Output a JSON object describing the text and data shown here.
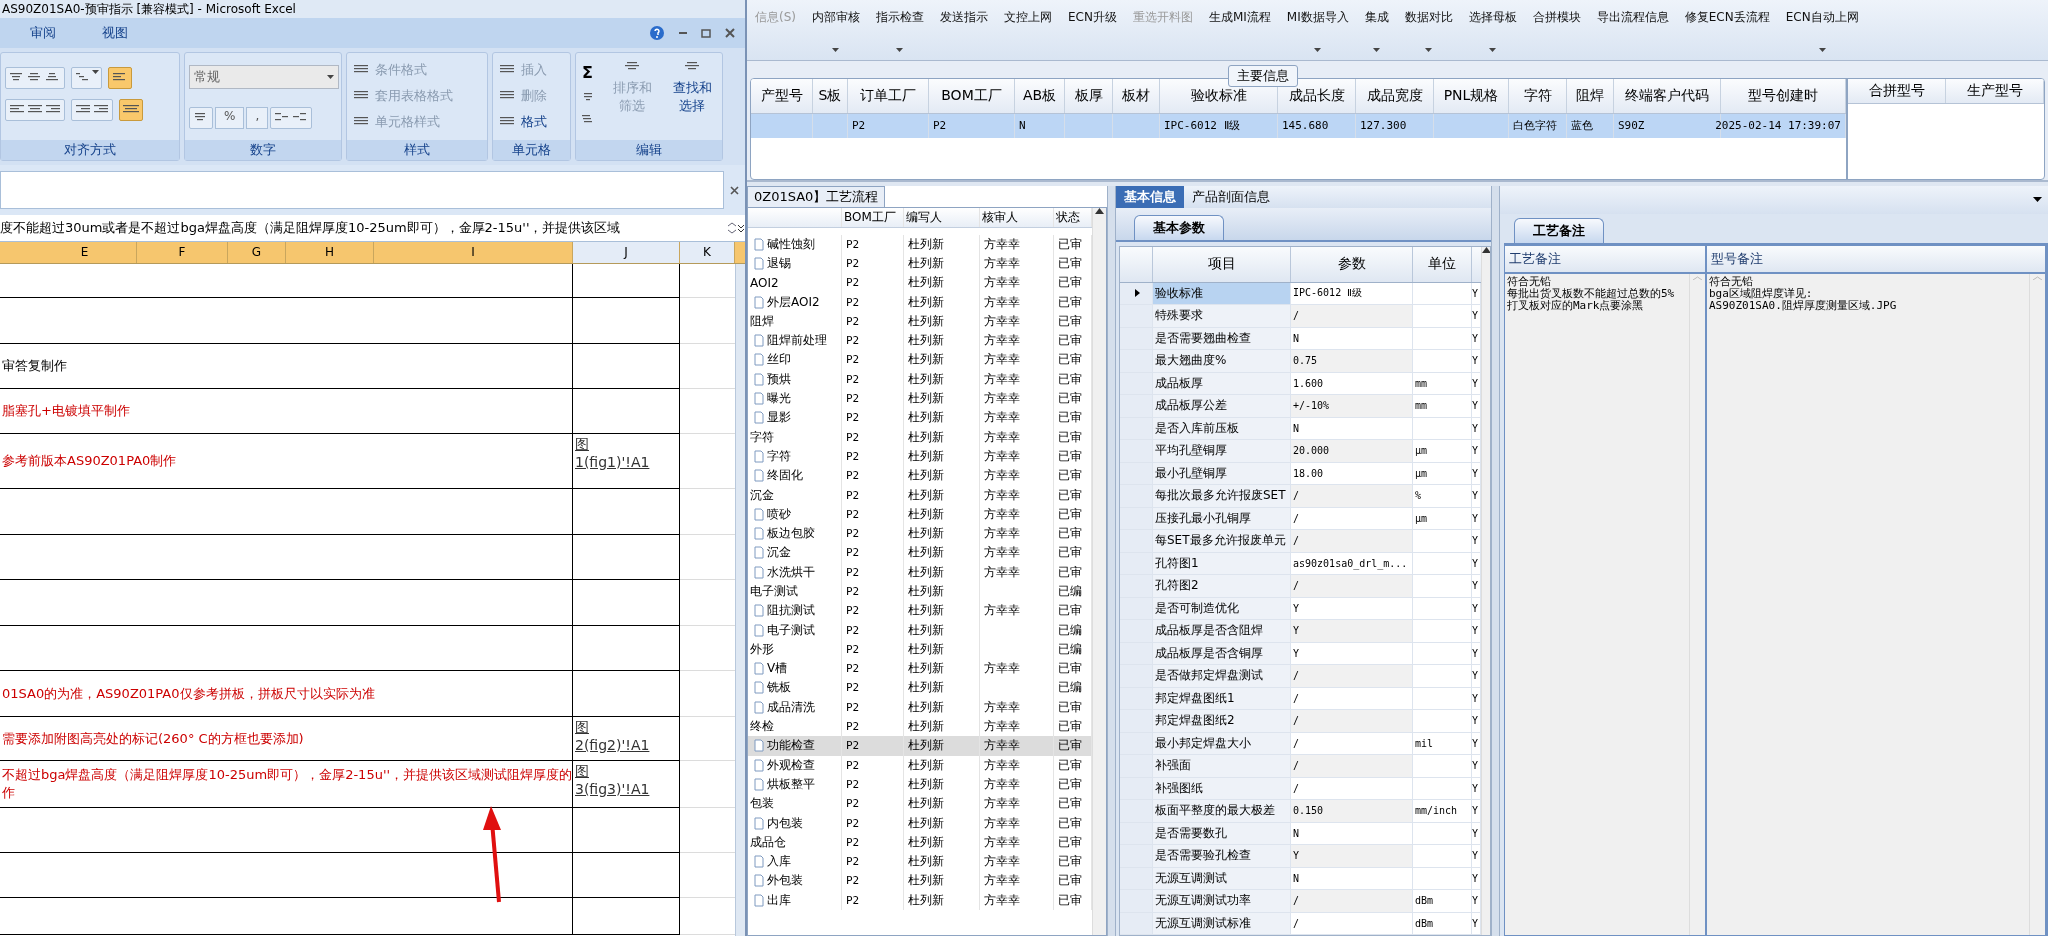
{
  "excel": {
    "title": "AS90Z01SA0-预审指示 [兼容模式] - Microsoft Excel",
    "ribbon_tabs": [
      {
        "label": "审阅",
        "selected": false
      },
      {
        "label": "视图",
        "selected": false
      }
    ],
    "alignment": {
      "label": "对齐方式",
      "wrap_text": true,
      "merge_center": true
    },
    "number": {
      "label": "数字",
      "format": "常规",
      "symbols": [
        "%",
        ","
      ]
    },
    "styles": {
      "label": "样式",
      "items": [
        {
          "label": "条件格式",
          "disabled": true
        },
        {
          "label": "套用表格格式",
          "disabled": true
        },
        {
          "label": "单元格样式",
          "disabled": true
        }
      ]
    },
    "cells": {
      "label": "单元格",
      "items": [
        {
          "label": "插入",
          "disabled": true
        },
        {
          "label": "删除",
          "disabled": true
        },
        {
          "label": "格式",
          "disabled": false
        }
      ]
    },
    "editing": {
      "label": "编辑",
      "sum": "Σ",
      "items": [
        {
          "label": "排序和筛选",
          "disabled": true
        },
        {
          "label": "查找和选择",
          "disabled": false
        }
      ]
    },
    "formula": "度不能超过30um或者是不超过bga焊盘高度（满足阻焊厚度10-25um即可），金厚2-15u''，并提供该区域",
    "columns": [
      "E",
      "F",
      "G",
      "H",
      "I",
      "J",
      "K"
    ],
    "rows": [
      {},
      {},
      {
        "lines": [
          "审答复制作"
        ],
        "color": "#000000"
      },
      {
        "lines": [
          "脂塞孔+电镀填平制作"
        ],
        "color": "#cc0000"
      },
      {
        "lines": [
          "参考前版本AS90Z01PA0制作"
        ],
        "color": "#cc0000",
        "link": "图 1(fig1)'!A1"
      },
      {},
      {},
      {},
      {},
      {
        "lines": [
          "01SA0的为准，AS90Z01PA0仅参考拼板，拼板尺寸以实际为准"
        ],
        "color": "#cc0000"
      },
      {
        "lines": [
          "需要添加附图高亮处的标记(260° C的方框也要添加)"
        ],
        "color": "#cc0000",
        "link": "图 2(fig2)'!A1"
      },
      {
        "lines": [
          "不超过bga焊盘高度（满足阻焊厚度10-25um即可），金厚2-15u''，并提供该区域测试阻焊厚度的",
          "作"
        ],
        "color": "#cc0000",
        "link": "图 3(fig3)'!A1"
      },
      {},
      {},
      {}
    ]
  },
  "toolbar": [
    {
      "label": "信息(S)",
      "disabled": true,
      "dropdown": false
    },
    {
      "label": "内部审核",
      "disabled": false,
      "dropdown": true
    },
    {
      "label": "指示检查",
      "disabled": false,
      "dropdown": true
    },
    {
      "label": "发送指示",
      "disabled": false,
      "dropdown": false
    },
    {
      "label": "文控上网",
      "disabled": false,
      "dropdown": false
    },
    {
      "label": "ECN升级",
      "disabled": false,
      "dropdown": false
    },
    {
      "label": "重选开料图",
      "disabled": true,
      "dropdown": false
    },
    {
      "label": "生成MI流程",
      "disabled": false,
      "dropdown": false
    },
    {
      "label": "MI数据导入",
      "disabled": false,
      "dropdown": true
    },
    {
      "label": "集成",
      "disabled": false,
      "dropdown": true
    },
    {
      "label": "数据对比",
      "disabled": false,
      "dropdown": true
    },
    {
      "label": "选择母板",
      "disabled": false,
      "dropdown": true
    },
    {
      "label": "合拼模块",
      "disabled": false,
      "dropdown": false
    },
    {
      "label": "导出流程信息",
      "disabled": false,
      "dropdown": false
    },
    {
      "label": "修复ECN丢流程",
      "disabled": false,
      "dropdown": false
    },
    {
      "label": "ECN自动上网",
      "disabled": false,
      "dropdown": true
    }
  ],
  "main_info": {
    "title": "主要信息",
    "columns": [
      "产型号",
      "S板",
      "订单工厂",
      "BOM工厂",
      "AB板",
      "板厚",
      "板材",
      "验收标准",
      "成品长度",
      "成品宽度",
      "PNL规格",
      "字符",
      "阻焊",
      "终端客户代码",
      "型号创建时"
    ],
    "rows": [
      {
        "selected": true,
        "cells": [
          "",
          "",
          "P2",
          "P2",
          "N",
          "",
          "",
          "IPC-6012 Ⅱ级",
          "145.680",
          "127.300",
          "",
          "白色字符",
          "蓝色",
          "S90Z",
          "2025-02-14 17:39:07"
        ]
      }
    ],
    "merge_columns": [
      "合拼型号",
      "生产型号"
    ]
  },
  "process": {
    "tab": "0Z01SA0】工艺流程",
    "columns": [
      "",
      "BOM工厂",
      "编写人",
      "核审人",
      "状态"
    ],
    "rows": [
      {
        "children": [
          {
            "name": "碱性蚀刻",
            "bom": "P2",
            "writer": "杜列新",
            "reviewer": "方幸幸",
            "status": "已审",
            "selected": false
          },
          {
            "name": "退锡",
            "bom": "P2",
            "writer": "杜列新",
            "reviewer": "方幸幸",
            "status": "已审",
            "selected": false
          }
        ]
      },
      {
        "name": "AOI2",
        "bom": "P2",
        "writer": "杜列新",
        "reviewer": "方幸幸",
        "status": "已审",
        "selected": false,
        "children": [
          {
            "name": "外层AOI2",
            "bom": "P2",
            "writer": "杜列新",
            "reviewer": "方幸幸",
            "status": "已审",
            "selected": false
          }
        ]
      },
      {
        "name": "阻焊",
        "bom": "P2",
        "writer": "杜列新",
        "reviewer": "方幸幸",
        "status": "已审",
        "selected": false,
        "children": [
          {
            "name": "阻焊前处理",
            "bom": "P2",
            "writer": "杜列新",
            "reviewer": "方幸幸",
            "status": "已审",
            "selected": false
          },
          {
            "name": "丝印",
            "bom": "P2",
            "writer": "杜列新",
            "reviewer": "方幸幸",
            "status": "已审",
            "selected": false
          },
          {
            "name": "预烘",
            "bom": "P2",
            "writer": "杜列新",
            "reviewer": "方幸幸",
            "status": "已审",
            "selected": false
          },
          {
            "name": "曝光",
            "bom": "P2",
            "writer": "杜列新",
            "reviewer": "方幸幸",
            "status": "已审",
            "selected": false
          },
          {
            "name": "显影",
            "bom": "P2",
            "writer": "杜列新",
            "reviewer": "方幸幸",
            "status": "已审",
            "selected": false
          }
        ]
      },
      {
        "name": "字符",
        "bom": "P2",
        "writer": "杜列新",
        "reviewer": "方幸幸",
        "status": "已审",
        "selected": false,
        "children": [
          {
            "name": "字符",
            "bom": "P2",
            "writer": "杜列新",
            "reviewer": "方幸幸",
            "status": "已审",
            "selected": false
          },
          {
            "name": "终固化",
            "bom": "P2",
            "writer": "杜列新",
            "reviewer": "方幸幸",
            "status": "已审",
            "selected": false
          }
        ]
      },
      {
        "name": "沉金",
        "bom": "P2",
        "writer": "杜列新",
        "reviewer": "方幸幸",
        "status": "已审",
        "selected": false,
        "children": [
          {
            "name": "喷砂",
            "bom": "P2",
            "writer": "杜列新",
            "reviewer": "方幸幸",
            "status": "已审",
            "selected": false
          },
          {
            "name": "板边包胶",
            "bom": "P2",
            "writer": "杜列新",
            "reviewer": "方幸幸",
            "status": "已审",
            "selected": false
          },
          {
            "name": "沉金",
            "bom": "P2",
            "writer": "杜列新",
            "reviewer": "方幸幸",
            "status": "已审",
            "selected": false
          },
          {
            "name": "水洗烘干",
            "bom": "P2",
            "writer": "杜列新",
            "reviewer": "方幸幸",
            "status": "已审",
            "selected": false
          }
        ]
      },
      {
        "name": "电子测试",
        "bom": "P2",
        "writer": "杜列新",
        "status": "已编",
        "selected": false,
        "children": [
          {
            "name": "阻抗测试",
            "bom": "P2",
            "writer": "杜列新",
            "reviewer": "方幸幸",
            "status": "已审",
            "selected": false
          },
          {
            "name": "电子测试",
            "bom": "P2",
            "writer": "杜列新",
            "status": "已编",
            "selected": false
          }
        ]
      },
      {
        "name": "外形",
        "bom": "P2",
        "writer": "杜列新",
        "status": "已编",
        "selected": false,
        "children": [
          {
            "name": "V槽",
            "bom": "P2",
            "writer": "杜列新",
            "reviewer": "方幸幸",
            "status": "已审",
            "selected": false
          },
          {
            "name": "铣板",
            "bom": "P2",
            "writer": "杜列新",
            "status": "已编",
            "selected": false
          },
          {
            "name": "成品清洗",
            "bom": "P2",
            "writer": "杜列新",
            "reviewer": "方幸幸",
            "status": "已审",
            "selected": false
          }
        ]
      },
      {
        "name": "终检",
        "bom": "P2",
        "writer": "杜列新",
        "reviewer": "方幸幸",
        "status": "已审",
        "selected": false,
        "children": [
          {
            "name": "功能检查",
            "bom": "P2",
            "writer": "杜列新",
            "reviewer": "方幸幸",
            "status": "已审",
            "selected": true
          },
          {
            "name": "外观检查",
            "bom": "P2",
            "writer": "杜列新",
            "reviewer": "方幸幸",
            "status": "已审",
            "selected": false
          },
          {
            "name": "烘板整平",
            "bom": "P2",
            "writer": "杜列新",
            "reviewer": "方幸幸",
            "status": "已审",
            "selected": false
          }
        ]
      },
      {
        "name": "包装",
        "bom": "P2",
        "writer": "杜列新",
        "reviewer": "方幸幸",
        "status": "已审",
        "selected": false,
        "children": [
          {
            "name": "内包装",
            "bom": "P2",
            "writer": "杜列新",
            "reviewer": "方幸幸",
            "status": "已审",
            "selected": false
          }
        ]
      },
      {
        "name": "成品仓",
        "bom": "P2",
        "writer": "杜列新",
        "reviewer": "方幸幸",
        "status": "已审",
        "selected": false,
        "children": [
          {
            "name": "入库",
            "bom": "P2",
            "writer": "杜列新",
            "reviewer": "方幸幸",
            "status": "已审",
            "selected": false
          },
          {
            "name": "外包装",
            "bom": "P2",
            "writer": "杜列新",
            "reviewer": "方幸幸",
            "status": "已审",
            "selected": false
          },
          {
            "name": "出库",
            "bom": "P2",
            "writer": "杜列新",
            "reviewer": "方幸幸",
            "status": "已审",
            "selected": false
          }
        ]
      }
    ]
  },
  "basic": {
    "tabs": [
      {
        "label": "基本信息",
        "selected": true
      },
      {
        "label": "产品剖面信息",
        "selected": false
      }
    ],
    "subtab": "基本参数",
    "columns": [
      "项目",
      "参数",
      "单位"
    ],
    "rows": [
      {
        "item": "验收标准",
        "value": "IPC-6012 Ⅱ级",
        "unit": "",
        "flag": "Y",
        "selected": true
      },
      {
        "item": "特殊要求",
        "value": "/",
        "unit": "",
        "flag": "Y",
        "selected": false
      },
      {
        "item": "是否需要翘曲检查",
        "value": "N",
        "unit": "",
        "flag": "Y",
        "selected": false
      },
      {
        "item": "最大翘曲度%",
        "value": "0.75",
        "unit": "",
        "flag": "Y",
        "selected": false
      },
      {
        "item": "成品板厚",
        "value": "1.600",
        "unit": "mm",
        "flag": "Y",
        "selected": false
      },
      {
        "item": "成品板厚公差",
        "value": "+/-10%",
        "unit": "mm",
        "flag": "Y",
        "selected": false
      },
      {
        "item": "是否入库前压板",
        "value": "N",
        "unit": "",
        "flag": "Y",
        "selected": false
      },
      {
        "item": "平均孔壁铜厚",
        "value": "20.000",
        "unit": "μm",
        "flag": "Y",
        "selected": false
      },
      {
        "item": "最小孔壁铜厚",
        "value": "18.00",
        "unit": "μm",
        "flag": "Y",
        "selected": false
      },
      {
        "item": "每批次最多允许报废SET",
        "value": "/",
        "unit": "%",
        "flag": "Y",
        "selected": false
      },
      {
        "item": "压接孔最小孔铜厚",
        "value": "/",
        "unit": "μm",
        "flag": "Y",
        "selected": false
      },
      {
        "item": "每SET最多允许报废单元",
        "value": "/",
        "unit": "",
        "flag": "Y",
        "selected": false
      },
      {
        "item": "孔符图1",
        "value": "as90z01sa0_drl_m...",
        "unit": "",
        "flag": "Y",
        "selected": false
      },
      {
        "item": "孔符图2",
        "value": "/",
        "unit": "",
        "flag": "Y",
        "selected": false
      },
      {
        "item": "是否可制造优化",
        "value": "Y",
        "unit": "",
        "flag": "Y",
        "selected": false
      },
      {
        "item": "成品板厚是否含阻焊",
        "value": "Y",
        "unit": "",
        "flag": "Y",
        "selected": false
      },
      {
        "item": "成品板厚是否含铜厚",
        "value": "Y",
        "unit": "",
        "flag": "Y",
        "selected": false
      },
      {
        "item": "是否做邦定焊盘测试",
        "value": "/",
        "unit": "",
        "flag": "Y",
        "selected": false
      },
      {
        "item": "邦定焊盘图纸1",
        "value": "/",
        "unit": "",
        "flag": "Y",
        "selected": false
      },
      {
        "item": "邦定焊盘图纸2",
        "value": "/",
        "unit": "",
        "flag": "Y",
        "selected": false
      },
      {
        "item": "最小邦定焊盘大小",
        "value": "/",
        "unit": "mil",
        "flag": "Y",
        "selected": false
      },
      {
        "item": "补强面",
        "value": "/",
        "unit": "",
        "flag": "Y",
        "selected": false
      },
      {
        "item": "补强图纸",
        "value": "/",
        "unit": "",
        "flag": "Y",
        "selected": false
      },
      {
        "item": "板面平整度的最大极差",
        "value": "0.150",
        "unit": "mm/inch",
        "flag": "Y",
        "selected": false
      },
      {
        "item": "是否需要数孔",
        "value": "N",
        "unit": "",
        "flag": "Y",
        "selected": false
      },
      {
        "item": "是否需要验孔检查",
        "value": "Y",
        "unit": "",
        "flag": "Y",
        "selected": false
      },
      {
        "item": "无源互调测试",
        "value": "N",
        "unit": "",
        "flag": "Y",
        "selected": false
      },
      {
        "item": "无源互调测试功率",
        "value": "/",
        "unit": "dBm",
        "flag": "Y",
        "selected": false
      },
      {
        "item": "无源互调测试标准",
        "value": "/",
        "unit": "dBm",
        "flag": "Y",
        "selected": false
      }
    ]
  },
  "notes": {
    "tab": "工艺备注",
    "columns": [
      "工艺备注",
      "型号备注"
    ],
    "process_note": [
      "符合无铅",
      "每批出货叉板数不能超过总数的5%",
      "打叉板对应的Mark点要涂黑"
    ],
    "model_note": [
      "符合无铅",
      "bga区域阻焊度详见:",
      "AS90Z01SA0.阻焊厚度测量区域.JPG"
    ]
  }
}
